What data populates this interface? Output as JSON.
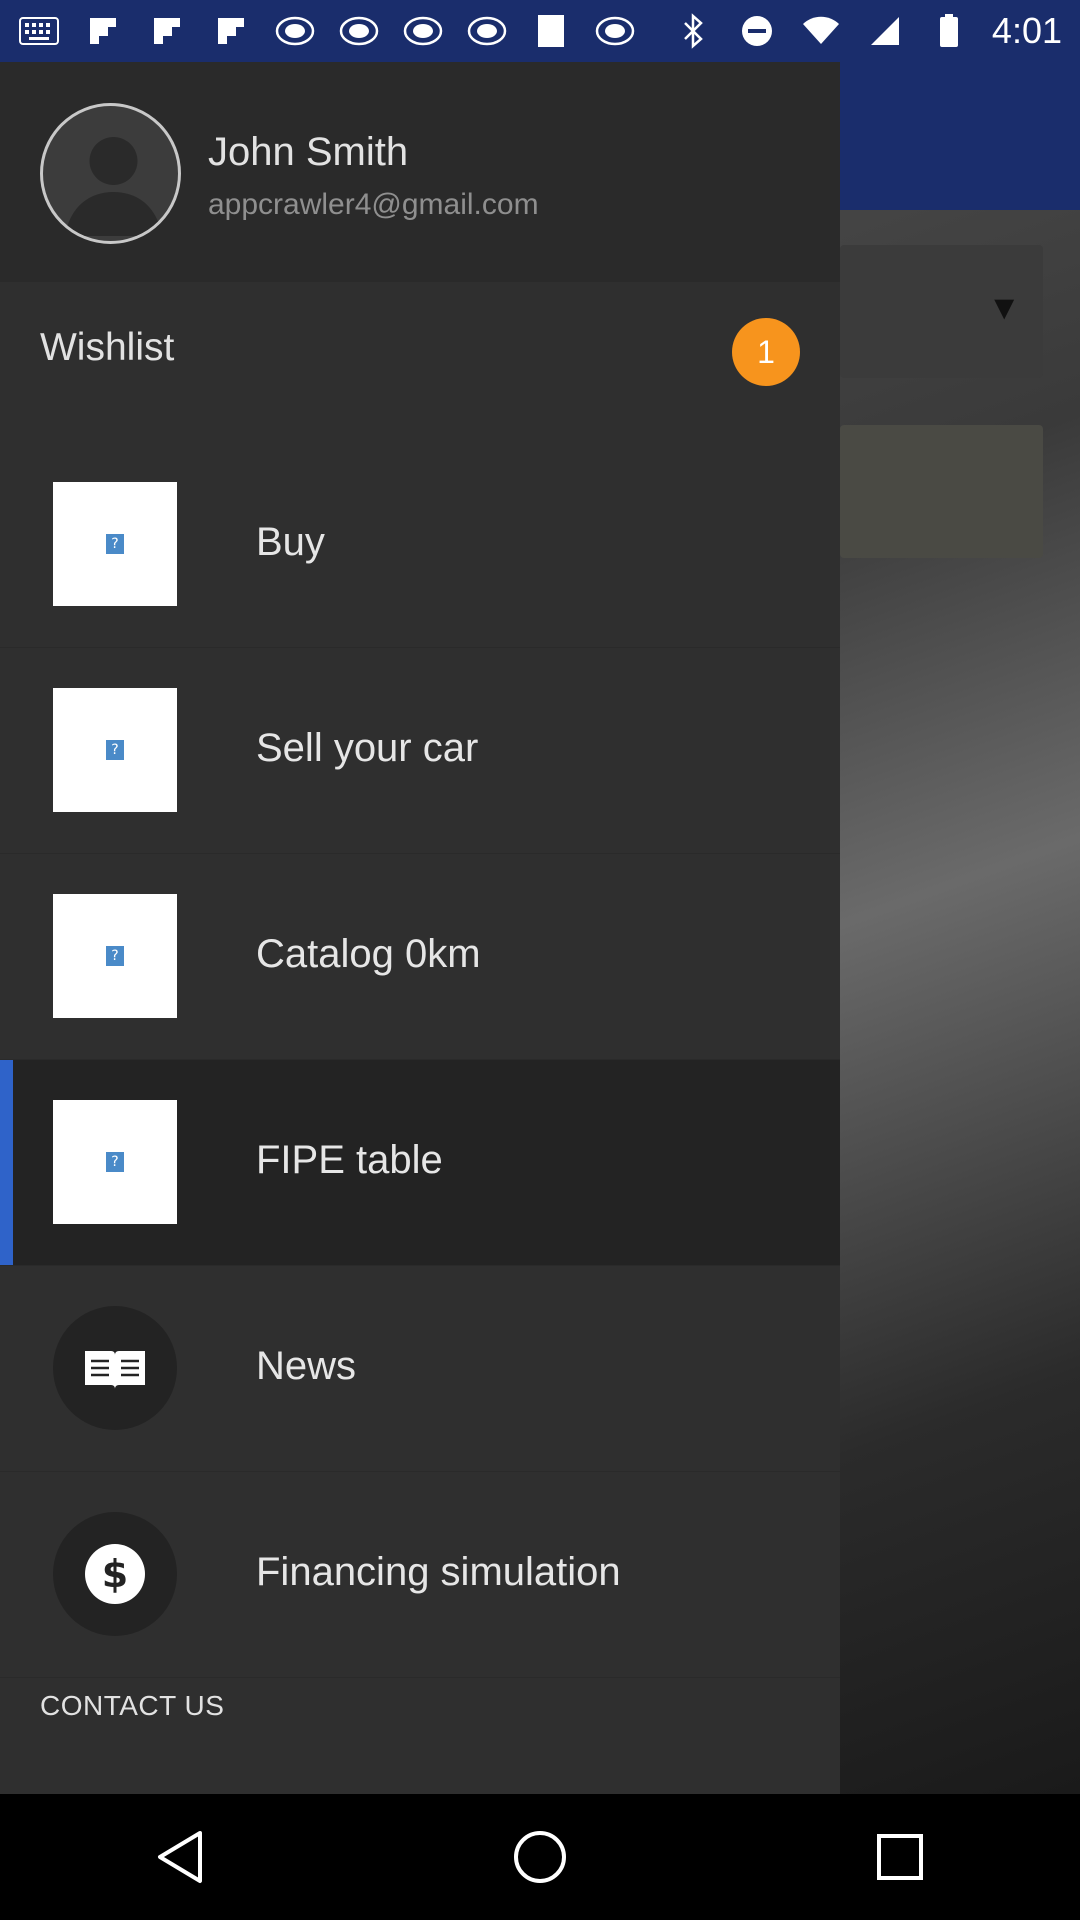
{
  "status_bar": {
    "time": "4:01",
    "left_icons": [
      "keyboard-icon",
      "flipboard-icon",
      "flipboard-icon",
      "flipboard-icon",
      "abc13-icon",
      "abc13-icon",
      "abc13-icon",
      "abc13-icon",
      "blank-icon",
      "abc13-icon"
    ],
    "right_icons": [
      "bluetooth-icon",
      "do-not-disturb-icon",
      "wifi-icon",
      "signal-icon",
      "battery-icon"
    ]
  },
  "drawer": {
    "user": {
      "name": "John Smith",
      "email": "appcrawler4@gmail.com"
    },
    "wishlist": {
      "label": "Wishlist",
      "count": "1"
    },
    "items": [
      {
        "label": "Buy",
        "icon": "image-placeholder-icon",
        "selected": false
      },
      {
        "label": "Sell your car",
        "icon": "image-placeholder-icon",
        "selected": false
      },
      {
        "label": "Catalog 0km",
        "icon": "image-placeholder-icon",
        "selected": false
      },
      {
        "label": "FIPE table",
        "icon": "image-placeholder-icon",
        "selected": true
      },
      {
        "label": "News",
        "icon": "news-book-icon",
        "selected": false
      },
      {
        "label": "Financing simulation",
        "icon": "dollar-icon",
        "selected": false
      }
    ],
    "contact_label": "CONTACT US"
  },
  "colors": {
    "status_bar": "#1a2d6c",
    "drawer_bg": "#2f2f2f",
    "selected_accent": "#2f63c9",
    "badge": "#f7941d"
  },
  "nav": {
    "buttons": [
      "back-icon",
      "home-icon",
      "recents-icon"
    ]
  }
}
